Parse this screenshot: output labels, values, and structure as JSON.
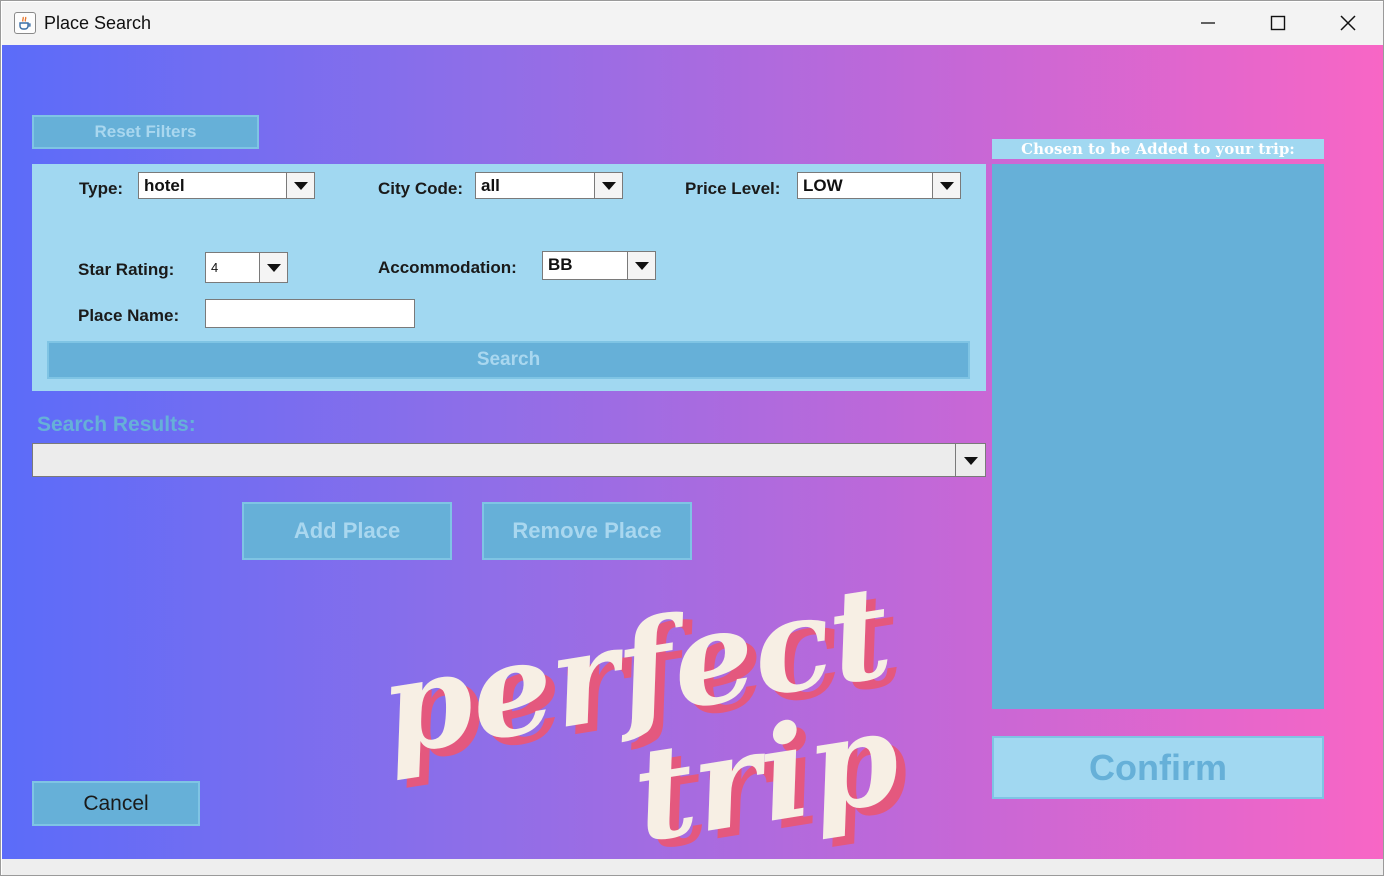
{
  "window": {
    "title": "Place Search"
  },
  "icons": {
    "app": "java-cup-icon",
    "minimize": "minimize-icon",
    "maximize": "maximize-icon",
    "close": "close-icon",
    "dropdown": "chevron-down-icon"
  },
  "filters": {
    "reset_label": "Reset Filters",
    "type": {
      "label": "Type:",
      "value": "hotel"
    },
    "city_code": {
      "label": "City Code:",
      "value": "all"
    },
    "price_level": {
      "label": "Price Level:",
      "value": "LOW"
    },
    "star_rating": {
      "label": "Star Rating:",
      "value": "4"
    },
    "accommodation": {
      "label": "Accommodation:",
      "value": "BB"
    },
    "place_name": {
      "label": "Place Name:",
      "value": ""
    },
    "search_label": "Search"
  },
  "results": {
    "label": "Search Results:",
    "value": ""
  },
  "actions": {
    "add_label": "Add Place",
    "remove_label": "Remove Place",
    "cancel_label": "Cancel"
  },
  "chosen": {
    "label": "Chosen to be Added to your trip:",
    "items": [],
    "confirm_label": "Confirm"
  },
  "logo": {
    "line1": "perfect",
    "line2": "trip"
  },
  "colors": {
    "gradient_start": "#5b6cf9",
    "gradient_end": "#f866c5",
    "panel": "#a1d8f1",
    "button": "#66b0d8",
    "muted_text": "#a9d7ef",
    "logo_text": "#f7efe4",
    "logo_shadow": "#e4587e"
  }
}
